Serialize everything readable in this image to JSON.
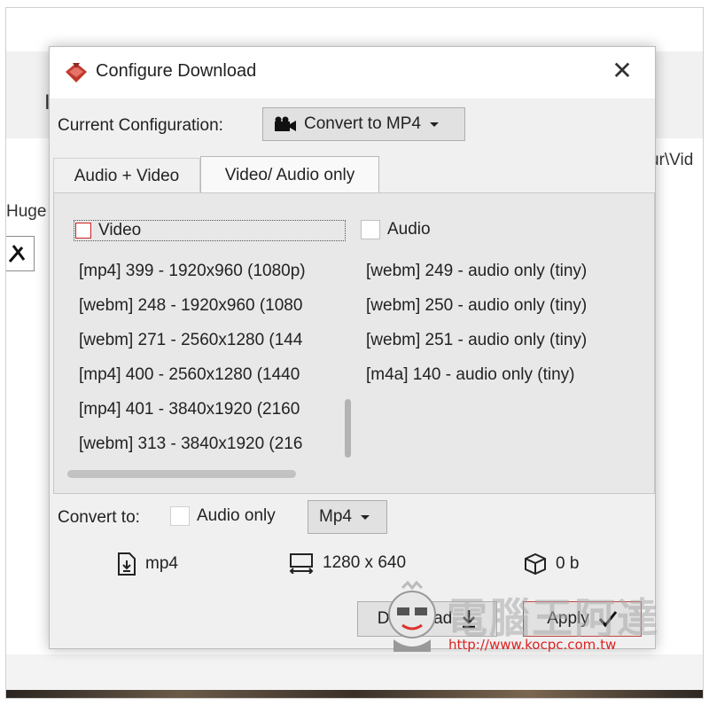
{
  "background": {
    "partial_char": "I",
    "path_fragment": "ur\\Vid",
    "label_fragment": "Huge"
  },
  "dialog": {
    "title": "Configure Download",
    "close_glyph": "✕",
    "current_config_label": "Current Configuration:",
    "current_config_value": "Convert to MP4",
    "tabs": [
      {
        "label": "Audio + Video",
        "active": false
      },
      {
        "label": "Video/ Audio only",
        "active": true
      }
    ],
    "video": {
      "label": "Video",
      "checked": false,
      "items": [
        "[mp4] 399 - 1920x960 (1080p)",
        "[webm] 248 - 1920x960 (1080",
        "[webm] 271 - 2560x1280 (144",
        "[mp4] 400 - 2560x1280 (1440",
        "[mp4] 401 - 3840x1920 (2160",
        "[webm] 313 - 3840x1920 (216"
      ]
    },
    "audio": {
      "label": "Audio",
      "checked": false,
      "items": [
        "[webm] 249 - audio only (tiny)",
        "[webm] 250 - audio only (tiny)",
        "[webm] 251 - audio only (tiny)",
        "[m4a] 140 - audio only (tiny)"
      ]
    },
    "convert": {
      "label": "Convert to:",
      "audio_only_label": "Audio only",
      "audio_only_checked": false,
      "format": "Mp4"
    },
    "info": {
      "extension": "mp4",
      "resolution": "1280 x 640",
      "size": "0 b"
    },
    "buttons": {
      "download": "Download",
      "apply": "Apply"
    }
  },
  "watermark": {
    "text": "電腦王阿達",
    "url": "http://www.kocpc.com.tw"
  },
  "colors": {
    "accent_red": "#c84444",
    "app_icon_red": "#c0392b",
    "dialog_bg": "#f0f0f0"
  },
  "icons": {
    "app": "app-logo-icon",
    "close": "close-icon",
    "camera": "video-camera-icon",
    "file": "file-download-icon",
    "resolution": "resolution-icon",
    "size": "package-box-icon",
    "download": "download-arrow-icon",
    "apply": "checkmark-icon"
  }
}
